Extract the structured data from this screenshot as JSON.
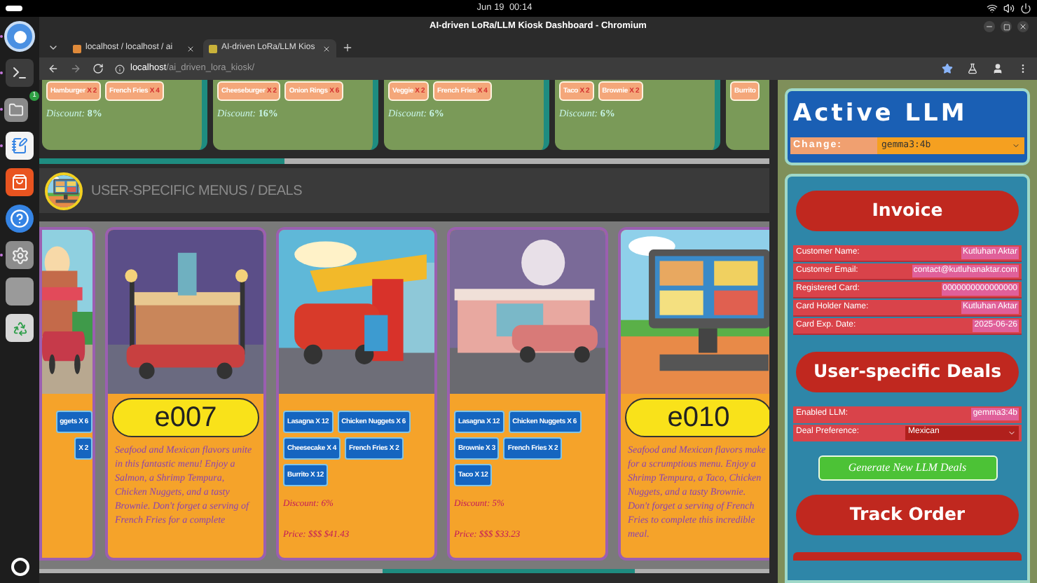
{
  "system_bar": {
    "date": "Jun 19",
    "time": "00:14"
  },
  "dock": {
    "items": [
      {
        "kind": "browser",
        "running": true
      },
      {
        "kind": "terminal",
        "running": true
      },
      {
        "kind": "files",
        "running": true,
        "badge": "1"
      },
      {
        "kind": "editor",
        "running": true
      },
      {
        "kind": "store",
        "running": false
      },
      {
        "kind": "help",
        "running": false
      },
      {
        "kind": "settings",
        "running": true
      },
      {
        "kind": "blank",
        "running": false
      },
      {
        "kind": "trash",
        "running": false
      }
    ]
  },
  "browser": {
    "title": "AI-driven LoRa/LLM Kiosk Dashboard - Chromium",
    "tabs": [
      {
        "title": "localhost / localhost / ai",
        "selected": false
      },
      {
        "title": "AI-driven LoRa/LLM Kios",
        "selected": true
      }
    ],
    "url_host": "localhost",
    "url_path": "/ai_driven_lora_kiosk/"
  },
  "top_menus": [
    {
      "items": [
        {
          "name": "Hamburger",
          "qty": "X 2"
        },
        {
          "name": "French Fries",
          "qty": "X 4"
        }
      ],
      "discount_label": "Discount:",
      "discount": "8%"
    },
    {
      "items": [
        {
          "name": "Cheeseburger",
          "qty": "X 2"
        },
        {
          "name": "Onion Rings",
          "qty": "X 6"
        }
      ],
      "discount_label": "Discount:",
      "discount": "16%"
    },
    {
      "items": [
        {
          "name": "Veggie",
          "qty": "X 2"
        },
        {
          "name": "French Fries",
          "qty": "X 4"
        }
      ],
      "discount_label": "Discount:",
      "discount": "6%"
    },
    {
      "items": [
        {
          "name": "Taco",
          "qty": "X 2"
        },
        {
          "name": "Brownie",
          "qty": "X 2"
        }
      ],
      "discount_label": "Discount:",
      "discount": "6%"
    },
    {
      "items": [
        {
          "name": "Burrito"
        }
      ]
    }
  ],
  "section": {
    "title": "USER-SPECIFIC MENUS / DEALS"
  },
  "deal_cards": [
    {
      "kind": "items",
      "items": [
        {
          "name": "ggets",
          "qty": "X 6"
        },
        {
          "qty": "X 2"
        }
      ]
    },
    {
      "kind": "code",
      "code": "e007",
      "description": "Seafood and Mexican flavors unite in this fantastic menu! Enjoy a Salmon, a Shrimp Tempura, Chicken Nuggets, and a tasty Brownie. Don't forget a serving of French Fries for a complete"
    },
    {
      "kind": "items",
      "items": [
        {
          "name": "Lasagna",
          "qty": "X 12"
        },
        {
          "name": "Chicken Nuggets",
          "qty": "X 6"
        },
        {
          "name": "Cheesecake",
          "qty": "X 4"
        },
        {
          "name": "French Fries",
          "qty": "X 2"
        },
        {
          "name": "Burrito",
          "qty": "X 12"
        }
      ],
      "discount": "Discount: 6%",
      "price": "Price: $$$ $41.43"
    },
    {
      "kind": "items",
      "items": [
        {
          "name": "Lasagna",
          "qty": "X 12"
        },
        {
          "name": "Chicken Nuggets",
          "qty": "X 6"
        },
        {
          "name": "Brownie",
          "qty": "X 3"
        },
        {
          "name": "French Fries",
          "qty": "X 2"
        },
        {
          "name": "Taco",
          "qty": "X 12"
        }
      ],
      "discount": "Discount: 5%",
      "price": "Price: $$$ $33.23"
    },
    {
      "kind": "code",
      "code": "e010",
      "description": "Seafood and Mexican flavors make for a scrumptious menu. Enjoy a Shrimp Tempura, a Taco, Chicken Nuggets, and a tasty Brownie. Don't forget a serving of French Fries to complete this incredible meal."
    }
  ],
  "sidebar": {
    "llm_title": "Active LLM",
    "change_label": "Change:",
    "model": "gemma3:4b",
    "invoice_button": "Invoice",
    "invoice_rows": [
      {
        "label": "Customer Name:",
        "value": "Kutluhan Aktar"
      },
      {
        "label": "Customer Email:",
        "value": "contact@kutluhanaktar.com"
      },
      {
        "label": "Registered Card:",
        "value": "0000000000000000"
      },
      {
        "label": "Card Holder Name:",
        "value": "Kutluhan Aktar"
      },
      {
        "label": "Card Exp. Date:",
        "value": "2025-06-26"
      }
    ],
    "deals_button": "User-specific Deals",
    "enabled_label": "Enabled LLM:",
    "enabled_value": "gemma3:4b",
    "preference_label": "Deal Preference:",
    "preference": "Mexican",
    "generate_button": "Generate New LLM Deals",
    "track_button": "Track Order"
  }
}
